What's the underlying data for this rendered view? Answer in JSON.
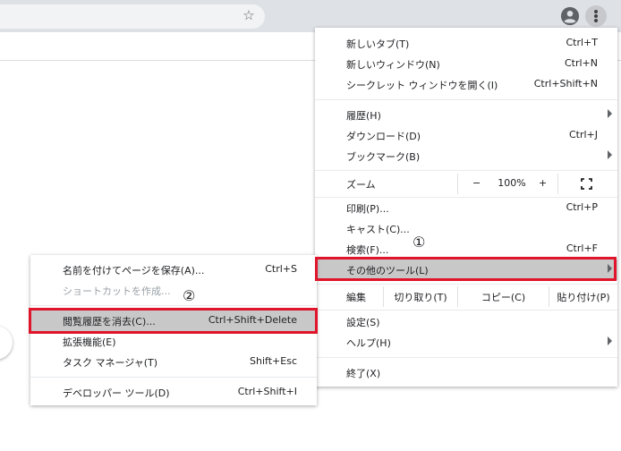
{
  "main_menu": {
    "items": [
      {
        "label": "新しいタブ(T)",
        "shortcut": "Ctrl+T"
      },
      {
        "label": "新しいウィンドウ(N)",
        "shortcut": "Ctrl+N"
      },
      {
        "label": "シークレット ウィンドウを開く(I)",
        "shortcut": "Ctrl+Shift+N"
      },
      {
        "label": "履歴(H)",
        "shortcut": ""
      },
      {
        "label": "ダウンロード(D)",
        "shortcut": "Ctrl+J"
      },
      {
        "label": "ブックマーク(B)",
        "shortcut": ""
      },
      {
        "label": "印刷(P)...",
        "shortcut": "Ctrl+P"
      },
      {
        "label": "キャスト(C)...",
        "shortcut": ""
      },
      {
        "label": "検索(F)...",
        "shortcut": "Ctrl+F"
      },
      {
        "label": "その他のツール(L)",
        "shortcut": ""
      },
      {
        "label": "設定(S)",
        "shortcut": ""
      },
      {
        "label": "ヘルプ(H)",
        "shortcut": ""
      },
      {
        "label": "終了(X)",
        "shortcut": ""
      }
    ],
    "zoom": {
      "label": "ズーム",
      "minus": "−",
      "value": "100%",
      "plus": "+"
    },
    "edit": {
      "label": "編集",
      "cut": "切り取り(T)",
      "copy": "コピー(C)",
      "paste": "貼り付け(P)"
    }
  },
  "sub_menu": {
    "items": [
      {
        "label": "名前を付けてページを保存(A)...",
        "shortcut": "Ctrl+S"
      },
      {
        "label": "ショートカットを作成...",
        "shortcut": ""
      },
      {
        "label": "閲覧履歴を消去(C)...",
        "shortcut": "Ctrl+Shift+Delete"
      },
      {
        "label": "拡張機能(E)",
        "shortcut": ""
      },
      {
        "label": "タスク マネージャ(T)",
        "shortcut": "Shift+Esc"
      },
      {
        "label": "デベロッパー ツール(D)",
        "shortcut": "Ctrl+Shift+I"
      }
    ]
  },
  "annotations": {
    "step1": "①",
    "step2": "②"
  },
  "colors": {
    "highlight_box": "#e0142a",
    "hover_bg": "#c8c8c8",
    "toolbar_bg": "#dee1e6"
  },
  "icons": {
    "bookmark": "star-icon",
    "profile": "account-circle-icon",
    "menu": "three-dots-vertical-icon",
    "fullscreen": "fullscreen-icon"
  }
}
